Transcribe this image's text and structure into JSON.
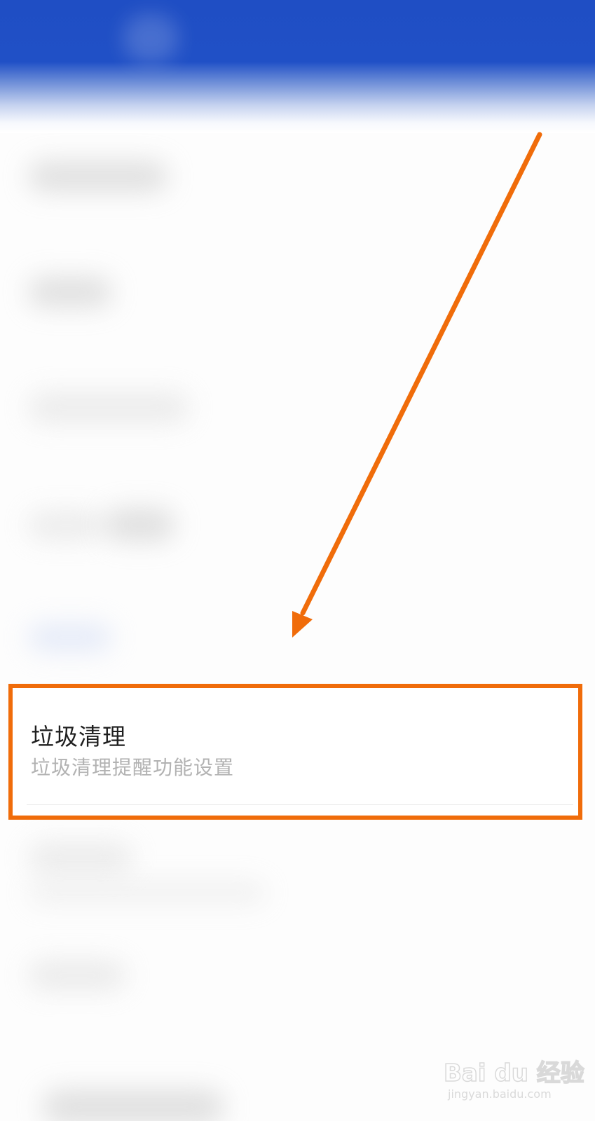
{
  "item": {
    "title": "垃圾清理",
    "subtitle": "垃圾清理提醒功能设置"
  },
  "watermark": {
    "brand": "Bai du 经验",
    "url": "jingyan.baidu.com"
  },
  "colors": {
    "header": "#2050c6",
    "highlight": "#f06c0a",
    "title_text": "#1f1f1f",
    "subtitle_text": "#b2b2b2"
  }
}
